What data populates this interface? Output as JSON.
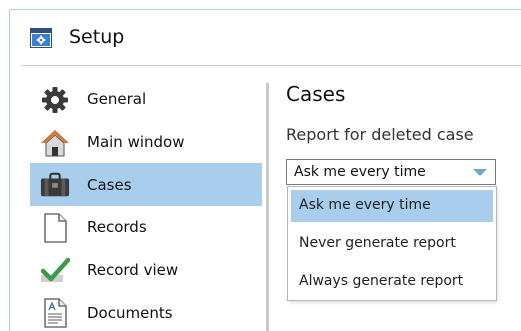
{
  "window": {
    "title": "Setup"
  },
  "sidebar": {
    "items": [
      {
        "label": "General",
        "icon": "gear-icon"
      },
      {
        "label": "Main window",
        "icon": "house-icon"
      },
      {
        "label": "Cases",
        "icon": "briefcase-icon",
        "selected": true
      },
      {
        "label": "Records",
        "icon": "blank-page-icon"
      },
      {
        "label": "Record view",
        "icon": "checkmark-icon"
      },
      {
        "label": "Documents",
        "icon": "text-document-icon"
      }
    ]
  },
  "main": {
    "section_title": "Cases",
    "field_label": "Report for deleted case",
    "select": {
      "value": "Ask me every time",
      "options": [
        "Ask me every time",
        "Never generate report",
        "Always generate report"
      ],
      "highlighted_index": 0
    }
  },
  "colors": {
    "selection": "#a9cdec",
    "window_border": "#a8d4e8",
    "dropdown_arrow": "#6aa7d8"
  }
}
